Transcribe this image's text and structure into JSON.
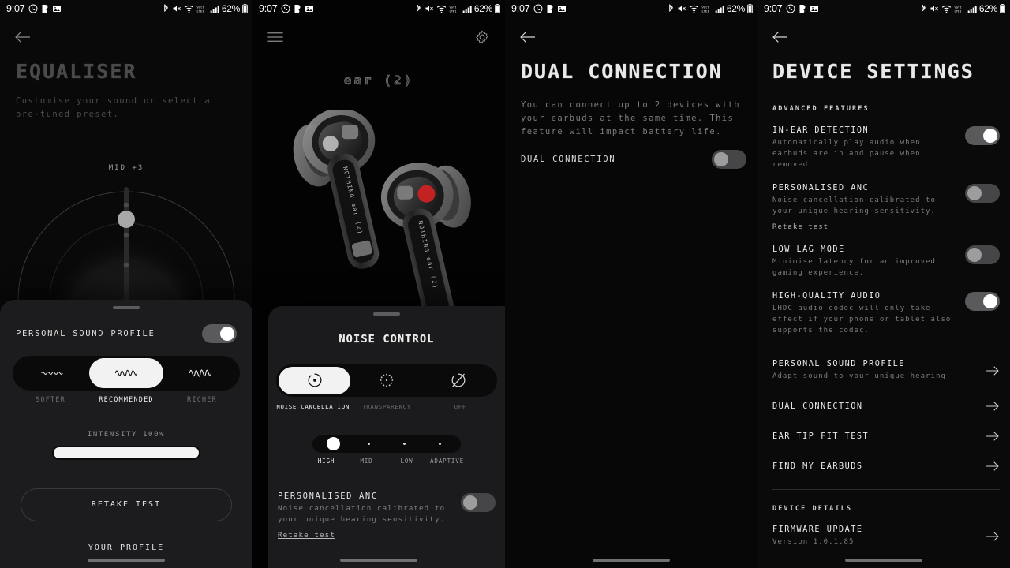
{
  "status_bar": {
    "time": "9:07",
    "battery": "62%",
    "left_icons": [
      "whatsapp-icon",
      "app-icon",
      "gallery-icon"
    ],
    "right_icons": [
      "bluetooth-icon",
      "mute-icon",
      "wifi-icon",
      "volte-icon",
      "signal-icon",
      "battery-icon"
    ]
  },
  "panel1": {
    "title": "EQUALISER",
    "subtitle": "Customise your sound or select a pre-tuned preset.",
    "eq": {
      "band_label": "MID +3"
    },
    "sheet": {
      "toggle_label": "PERSONAL SOUND PROFILE",
      "toggle_state": "on",
      "presets": [
        {
          "label": "SOFTER",
          "active": false
        },
        {
          "label": "RECOMMENDED",
          "active": true
        },
        {
          "label": "RICHER",
          "active": false
        }
      ],
      "intensity_label": "INTENSITY 100%",
      "intensity_value": 100,
      "retake_button": "RETAKE TEST",
      "your_profile_link": "YOUR PROFILE"
    }
  },
  "panel2": {
    "menu_icon": "hamburger-icon",
    "settings_icon": "gear-icon",
    "device_name": "ear (2)",
    "product_image": "nothing-ear-2-earbuds",
    "noise_control": {
      "title": "NOISE CONTROL",
      "modes": [
        {
          "label": "NOISE CANCELLATION",
          "icon": "anc-icon",
          "active": true
        },
        {
          "label": "TRANSPARENCY",
          "icon": "transparency-icon",
          "active": false
        },
        {
          "label": "OFF",
          "icon": "anc-off-icon",
          "active": false
        }
      ],
      "levels": [
        {
          "label": "HIGH",
          "active": true
        },
        {
          "label": "MID",
          "active": false
        },
        {
          "label": "LOW",
          "active": false
        },
        {
          "label": "ADAPTIVE",
          "active": false
        }
      ]
    },
    "personalised_anc": {
      "title": "PERSONALISED ANC",
      "description": "Noise cancellation calibrated to your unique hearing sensitivity.",
      "link": "Retake test",
      "toggle_state": "off"
    }
  },
  "panel3": {
    "title": "DUAL CONNECTION",
    "description": "You can connect up to 2 devices with your earbuds at the same time. This feature will impact battery life.",
    "row_label": "DUAL CONNECTION",
    "toggle_state": "off"
  },
  "panel4": {
    "title": "DEVICE SETTINGS",
    "advanced_features_caption": "ADVANCED FEATURES",
    "features": [
      {
        "title": "IN-EAR DETECTION",
        "description": "Automatically play audio when earbuds are in and pause when removed.",
        "toggle_state": "on"
      },
      {
        "title": "PERSONALISED ANC",
        "description": "Noise cancellation calibrated to your unique hearing sensitivity.",
        "link": "Retake test",
        "toggle_state": "off"
      },
      {
        "title": "LOW LAG MODE",
        "description": "Minimise latency for an improved gaming experience.",
        "toggle_state": "off"
      },
      {
        "title": "HIGH-QUALITY AUDIO",
        "description": "LHDC audio codec will only take effect if your phone or tablet also supports the codec.",
        "toggle_state": "on"
      }
    ],
    "nav_items": [
      {
        "title": "PERSONAL SOUND PROFILE",
        "description": "Adapt sound to your unique hearing."
      },
      {
        "title": "DUAL CONNECTION",
        "description": ""
      },
      {
        "title": "EAR TIP FIT TEST",
        "description": ""
      },
      {
        "title": "FIND MY EARBUDS",
        "description": ""
      }
    ],
    "device_details_caption": "DEVICE DETAILS",
    "firmware": {
      "title": "FIRMWARE UPDATE",
      "version": "Version 1.0.1.85"
    }
  }
}
